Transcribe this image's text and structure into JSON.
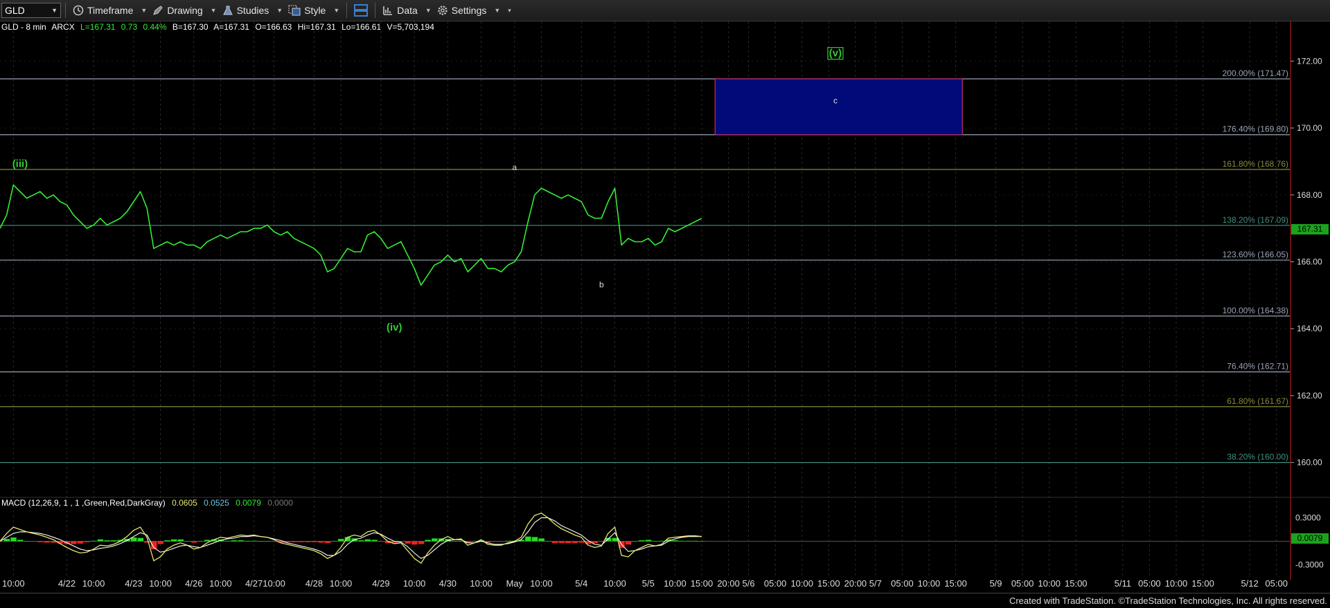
{
  "toolbar": {
    "symbol": "GLD",
    "timeframe": "Timeframe",
    "drawing": "Drawing",
    "studies": "Studies",
    "style": "Style",
    "data": "Data",
    "settings": "Settings"
  },
  "infobar": {
    "name": "GLD - 8 min",
    "exchange": "ARCX",
    "last": "L=167.31",
    "change": "0.73",
    "change_pct": "0.44%",
    "bid": "B=167.30",
    "ask": "A=167.31",
    "open": "O=166.63",
    "high": "Hi=167.31",
    "low": "Lo=166.61",
    "volume": "V=5,703,194"
  },
  "macd": {
    "label": "MACD (12,26,9, 1 , 1 ,Green,Red,DarkGray)",
    "v1": "0.0605",
    "v2": "0.0525",
    "v3": "0.0079",
    "v4": "0.0000",
    "current": "0.0079"
  },
  "current_price": "167.31",
  "footer": "Created with TradeStation. ©TradeStation Technologies, Inc. All rights reserved.",
  "colors": {
    "price_line": "#33ee33",
    "fib_gray": "#9aa3b5",
    "fib_olive": "#8a8a3a",
    "fib_teal": "#3f8f7f",
    "target_box_fill": "#000a78",
    "target_box_border": "#cc2a6a",
    "wave_label_green": "#33cc33",
    "macd_line": "#e8e870",
    "signal_line": "#ffffff",
    "hist_pos": "#22dd22",
    "hist_neg": "#ee2222"
  },
  "chart_data": {
    "type": "line",
    "symbol": "GLD",
    "interval": "8 min",
    "ylim": [
      159.0,
      173.0
    ],
    "y_ticks": [
      "172.00",
      "170.00",
      "168.00",
      "166.00",
      "164.00",
      "162.00",
      "160.00"
    ],
    "x_ticks": [
      {
        "label": "10:00",
        "i": 2
      },
      {
        "label": "4/22",
        "i": 10
      },
      {
        "label": "10:00",
        "i": 14
      },
      {
        "label": "4/23",
        "i": 20
      },
      {
        "label": "10:00",
        "i": 24
      },
      {
        "label": "4/26",
        "i": 29
      },
      {
        "label": "10:00",
        "i": 33
      },
      {
        "label": "4/27",
        "i": 38
      },
      {
        "label": "10:00",
        "i": 41
      },
      {
        "label": "4/28",
        "i": 47
      },
      {
        "label": "10:00",
        "i": 51
      },
      {
        "label": "4/29",
        "i": 57
      },
      {
        "label": "10:00",
        "i": 62
      },
      {
        "label": "4/30",
        "i": 67
      },
      {
        "label": "10:00",
        "i": 72
      },
      {
        "label": "May",
        "i": 77
      },
      {
        "label": "10:00",
        "i": 81
      },
      {
        "label": "5/4",
        "i": 87
      },
      {
        "label": "10:00",
        "i": 92
      },
      {
        "label": "5/5",
        "i": 97
      },
      {
        "label": "10:00",
        "i": 101
      },
      {
        "label": "15:00",
        "i": 105
      },
      {
        "label": "20:00",
        "i": 109
      },
      {
        "label": "5/6",
        "i": 112
      },
      {
        "label": "05:00",
        "i": 116
      },
      {
        "label": "10:00",
        "i": 120
      },
      {
        "label": "15:00",
        "i": 124
      },
      {
        "label": "20:00",
        "i": 128
      },
      {
        "label": "5/7",
        "i": 131
      },
      {
        "label": "05:00",
        "i": 135
      },
      {
        "label": "10:00",
        "i": 139
      },
      {
        "label": "15:00",
        "i": 143
      },
      {
        "label": "5/9",
        "i": 149
      },
      {
        "label": "05:00",
        "i": 153
      },
      {
        "label": "10:00",
        "i": 157
      },
      {
        "label": "15:00",
        "i": 161
      },
      {
        "label": "5/11",
        "i": 168
      },
      {
        "label": "05:00",
        "i": 172
      },
      {
        "label": "10:00",
        "i": 176
      },
      {
        "label": "15:00",
        "i": 180
      },
      {
        "label": "5/12",
        "i": 187
      },
      {
        "label": "05:00",
        "i": 191
      }
    ],
    "x_index_range": [
      0,
      193
    ],
    "price_series": [
      167.0,
      167.4,
      168.3,
      168.1,
      167.9,
      168.0,
      168.1,
      167.9,
      168.0,
      167.8,
      167.7,
      167.4,
      167.2,
      167.0,
      167.1,
      167.3,
      167.1,
      167.2,
      167.3,
      167.5,
      167.8,
      168.1,
      167.6,
      166.4,
      166.5,
      166.6,
      166.5,
      166.6,
      166.5,
      166.5,
      166.4,
      166.6,
      166.7,
      166.8,
      166.7,
      166.8,
      166.9,
      166.9,
      167.0,
      167.0,
      167.1,
      166.9,
      166.8,
      166.9,
      166.7,
      166.6,
      166.5,
      166.4,
      166.2,
      165.7,
      165.8,
      166.1,
      166.4,
      166.3,
      166.3,
      166.8,
      166.9,
      166.7,
      166.4,
      166.5,
      166.6,
      166.2,
      165.8,
      165.3,
      165.6,
      165.9,
      166.0,
      166.2,
      166.0,
      166.1,
      165.7,
      165.9,
      166.1,
      165.8,
      165.8,
      165.7,
      165.9,
      166.0,
      166.3,
      167.2,
      168.0,
      168.2,
      168.1,
      168.0,
      167.9,
      168.0,
      167.9,
      167.8,
      167.4,
      167.3,
      167.3,
      167.8,
      168.2,
      166.5,
      166.7,
      166.6,
      166.6,
      166.7,
      166.5,
      166.6,
      167.0,
      166.9,
      167.0,
      167.1,
      167.2,
      167.3
    ],
    "wave_labels": [
      {
        "text": "(iii)",
        "i": 3,
        "price": 168.9,
        "color": "green"
      },
      {
        "text": "(iv)",
        "i": 59,
        "price": 164.0,
        "color": "green"
      },
      {
        "text": "a",
        "i": 77,
        "price": 168.8,
        "color": "white"
      },
      {
        "text": "b",
        "i": 90,
        "price": 165.3,
        "color": "white"
      },
      {
        "text": "c",
        "i": 125,
        "price": 170.8,
        "color": "white"
      },
      {
        "text": "(v)",
        "i": 125,
        "price": 172.2,
        "color": "green-boxed"
      }
    ],
    "target_box": {
      "i_start": 107,
      "i_end": 144,
      "price_low": 169.8,
      "price_high": 171.47
    },
    "fib_levels": [
      {
        "pct": "200.00%",
        "price": 171.47,
        "label": "200.00% (171.47)",
        "color": "gray"
      },
      {
        "pct": "176.40%",
        "price": 169.8,
        "label": "176.40% (169.80)",
        "color": "gray"
      },
      {
        "pct": "161.80%",
        "price": 168.76,
        "label": "161.80% (168.76)",
        "color": "olive"
      },
      {
        "pct": "138.20%",
        "price": 167.09,
        "label": "138.20% (167.09)",
        "color": "teal"
      },
      {
        "pct": "123.60%",
        "price": 166.05,
        "label": "123.60% (166.05)",
        "color": "gray"
      },
      {
        "pct": "100.00%",
        "price": 164.38,
        "label": "100.00% (164.38)",
        "color": "gray"
      },
      {
        "pct": "76.40%",
        "price": 162.71,
        "label": "76.40% (162.71)",
        "color": "gray"
      },
      {
        "pct": "61.80%",
        "price": 161.67,
        "label": "61.80% (161.67)",
        "color": "olive"
      },
      {
        "pct": "38.20%",
        "price": 160.0,
        "label": "38.20% (160.00)",
        "color": "teal"
      }
    ],
    "macd_panel": {
      "ylim": [
        -0.42,
        0.42
      ],
      "y_ticks": [
        {
          "label": "0.3000",
          "v": 0.3
        },
        {
          "label": "-0.3000",
          "v": -0.3
        }
      ],
      "macd": [
        0.0,
        0.1,
        0.18,
        0.15,
        0.12,
        0.1,
        0.08,
        0.05,
        0.02,
        -0.03,
        -0.08,
        -0.12,
        -0.15,
        -0.14,
        -0.1,
        -0.05,
        -0.06,
        -0.04,
        0.0,
        0.06,
        0.14,
        0.18,
        0.05,
        -0.25,
        -0.2,
        -0.1,
        -0.05,
        -0.02,
        -0.05,
        -0.1,
        -0.08,
        -0.02,
        0.02,
        0.05,
        0.04,
        0.06,
        0.08,
        0.07,
        0.08,
        0.06,
        0.05,
        0.02,
        -0.02,
        -0.04,
        -0.06,
        -0.08,
        -0.1,
        -0.12,
        -0.16,
        -0.22,
        -0.18,
        -0.08,
        0.05,
        0.08,
        0.06,
        0.12,
        0.14,
        0.08,
        0.0,
        -0.03,
        -0.02,
        -0.12,
        -0.22,
        -0.28,
        -0.15,
        -0.05,
        0.02,
        0.06,
        0.02,
        0.03,
        -0.05,
        -0.02,
        0.02,
        -0.04,
        -0.05,
        -0.05,
        -0.02,
        0.0,
        0.05,
        0.22,
        0.33,
        0.36,
        0.3,
        0.22,
        0.16,
        0.12,
        0.08,
        0.05,
        -0.05,
        -0.08,
        -0.06,
        0.1,
        0.18,
        -0.18,
        -0.2,
        -0.12,
        -0.08,
        -0.04,
        -0.06,
        -0.04,
        0.04,
        0.05,
        0.06,
        0.07,
        0.07,
        0.06
      ],
      "signal": [
        0.0,
        0.05,
        0.1,
        0.12,
        0.12,
        0.11,
        0.1,
        0.08,
        0.05,
        0.02,
        -0.02,
        -0.06,
        -0.1,
        -0.12,
        -0.11,
        -0.09,
        -0.08,
        -0.06,
        -0.03,
        0.01,
        0.06,
        0.11,
        0.08,
        -0.08,
        -0.14,
        -0.12,
        -0.09,
        -0.06,
        -0.05,
        -0.07,
        -0.08,
        -0.05,
        -0.02,
        0.01,
        0.03,
        0.04,
        0.06,
        0.06,
        0.07,
        0.06,
        0.05,
        0.03,
        0.01,
        -0.02,
        -0.04,
        -0.06,
        -0.08,
        -0.1,
        -0.13,
        -0.18,
        -0.18,
        -0.13,
        -0.04,
        0.02,
        0.04,
        0.08,
        0.11,
        0.09,
        0.04,
        0.0,
        -0.01,
        -0.07,
        -0.15,
        -0.22,
        -0.18,
        -0.11,
        -0.04,
        0.01,
        0.02,
        0.02,
        -0.02,
        -0.02,
        0.0,
        -0.02,
        -0.04,
        -0.04,
        -0.03,
        -0.01,
        0.02,
        0.12,
        0.24,
        0.3,
        0.3,
        0.26,
        0.2,
        0.16,
        0.12,
        0.08,
        0.01,
        -0.04,
        -0.05,
        0.03,
        0.11,
        -0.04,
        -0.13,
        -0.12,
        -0.1,
        -0.07,
        -0.06,
        -0.05,
        0.0,
        0.03,
        0.05,
        0.06,
        0.06,
        0.06
      ]
    }
  }
}
